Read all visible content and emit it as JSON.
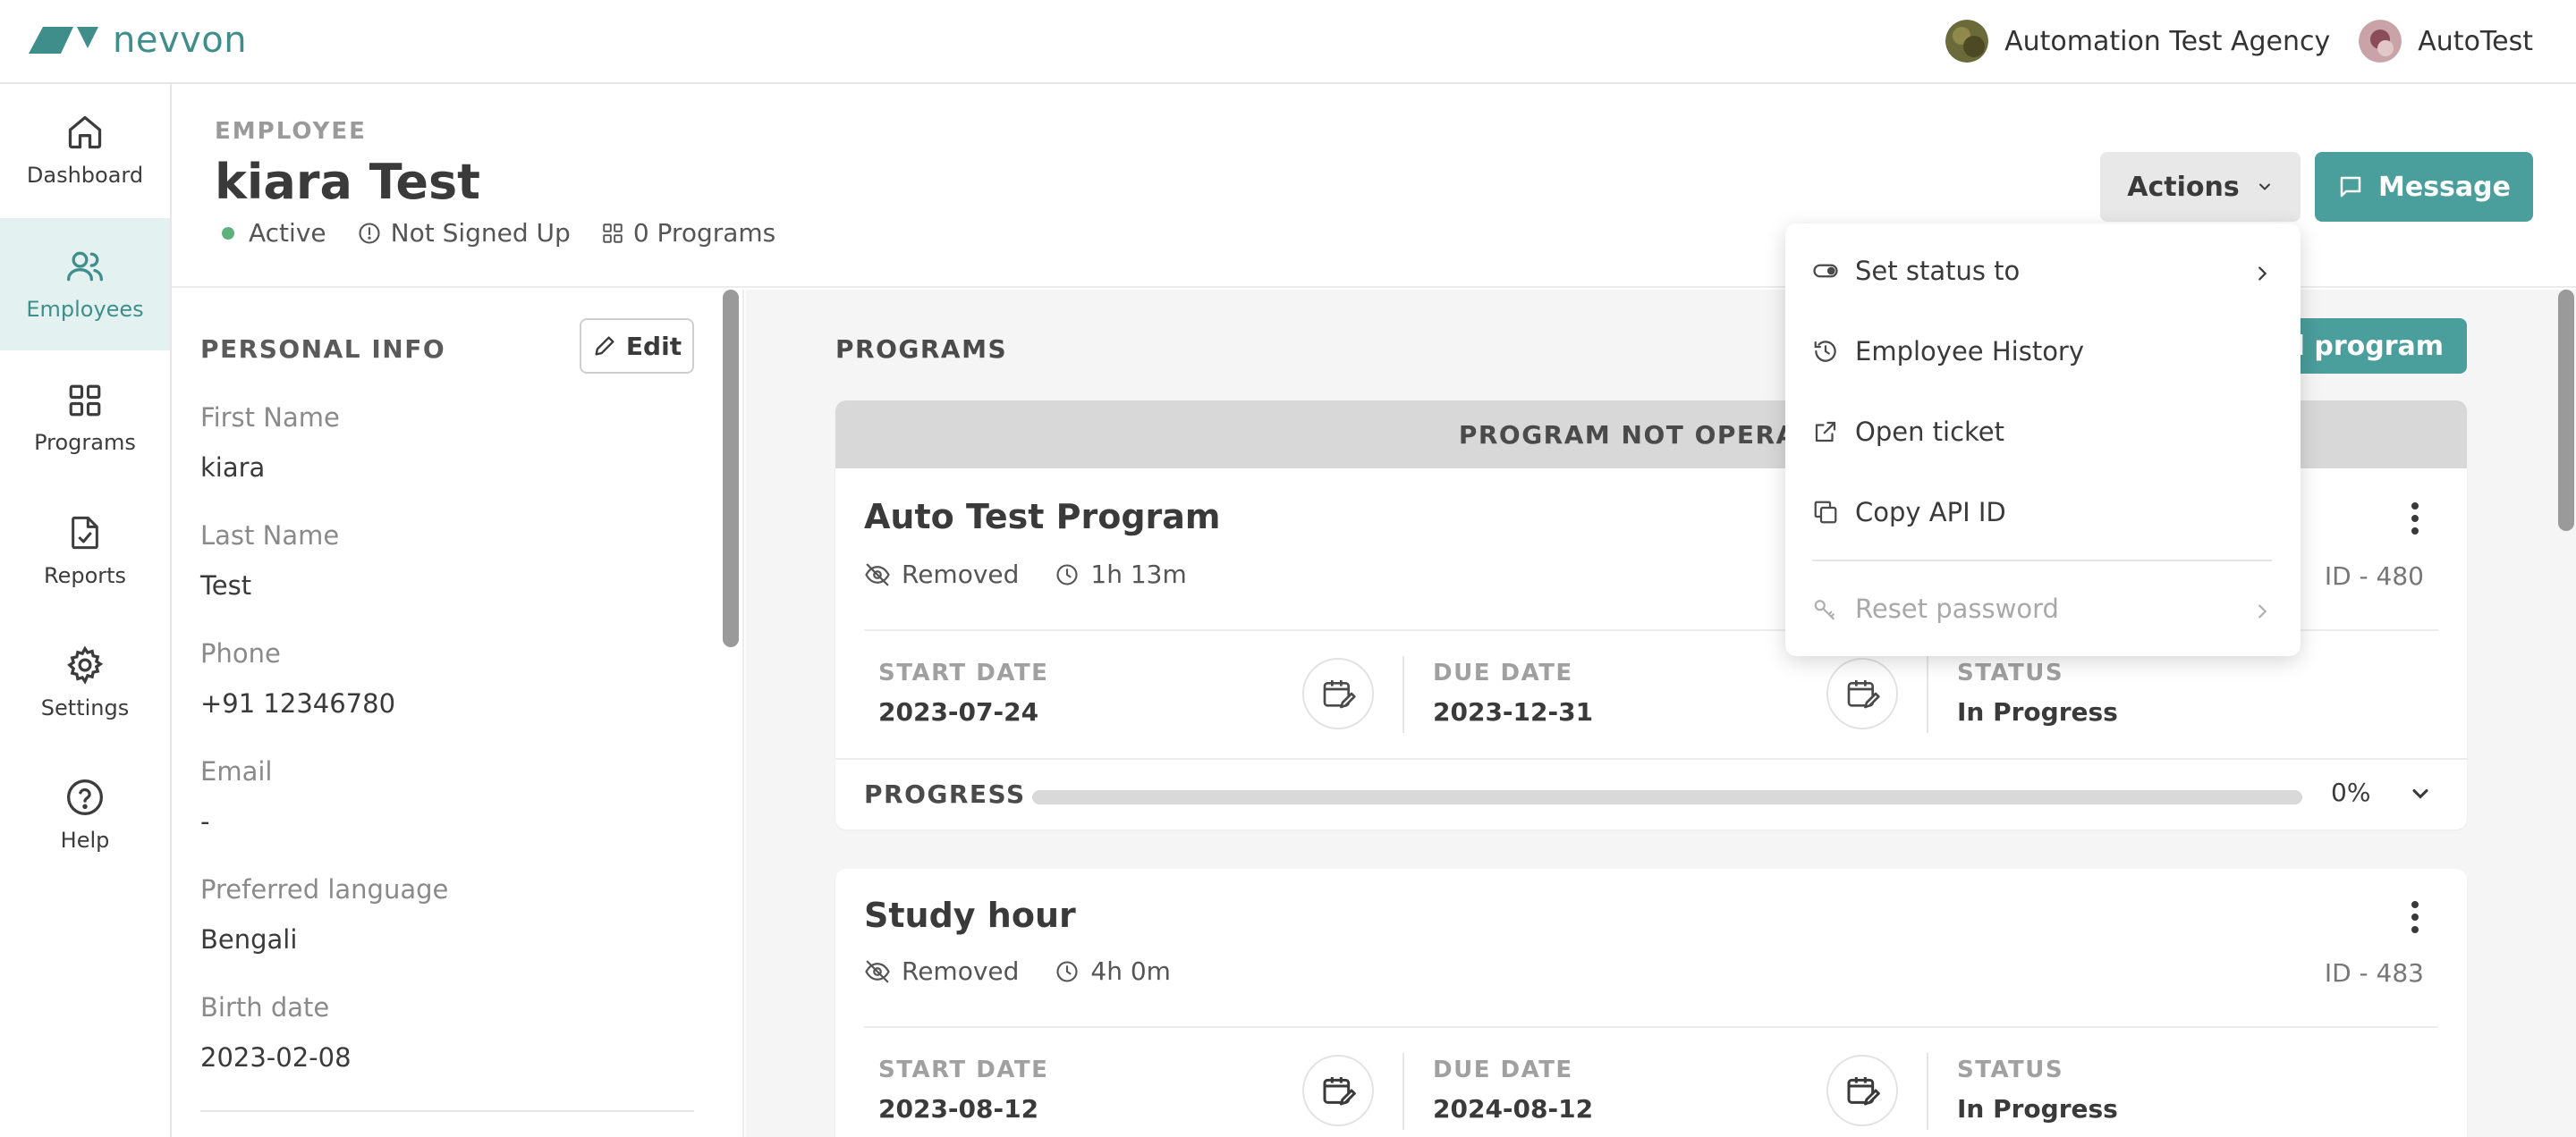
{
  "brand": {
    "name": "nevvon",
    "color": "#3f8e8c"
  },
  "topbar": {
    "org_name": "Automation Test Agency",
    "user_name": "AutoTest"
  },
  "nav": {
    "items": [
      {
        "label": "Dashboard",
        "icon": "home-icon",
        "active": false
      },
      {
        "label": "Employees",
        "icon": "users-icon",
        "active": true
      },
      {
        "label": "Programs",
        "icon": "grid-icon",
        "active": false
      },
      {
        "label": "Reports",
        "icon": "report-icon",
        "active": false
      },
      {
        "label": "Settings",
        "icon": "gear-icon",
        "active": false
      },
      {
        "label": "Help",
        "icon": "help-icon",
        "active": false
      }
    ]
  },
  "employee": {
    "eyebrow": "EMPLOYEE",
    "name": "kiara Test",
    "status": "Active",
    "signup": "Not Signed Up",
    "programs_count": "0 Programs"
  },
  "actions": {
    "actions_label": "Actions",
    "message_label": "Message"
  },
  "personal_info": {
    "title": "PERSONAL INFO",
    "edit_label": "Edit",
    "fields": [
      {
        "label": "First Name",
        "value": "kiara"
      },
      {
        "label": "Last Name",
        "value": "Test"
      },
      {
        "label": "Phone",
        "value": "+91 12346780"
      },
      {
        "label": "Email",
        "value": "-"
      },
      {
        "label": "Preferred language",
        "value": "Bengali"
      },
      {
        "label": "Birth date",
        "value": "2023-02-08"
      }
    ]
  },
  "programs": {
    "title": "PROGRAMS",
    "add_label": "dd program",
    "cards": [
      {
        "banner": "PROGRAM NOT OPERATIC",
        "title": "Auto Test Program",
        "visibility": "Removed",
        "duration": "1h 13m",
        "id_text": "ID - 480",
        "start_label": "START DATE",
        "start_date": "2023-07-24",
        "due_label": "DUE DATE",
        "due_date": "2023-12-31",
        "status_label": "STATUS",
        "status": "In Progress",
        "progress_label": "PROGRESS",
        "progress_text": "0%",
        "progress_value": 0
      },
      {
        "banner": "",
        "title": "Study hour",
        "visibility": "Removed",
        "duration": "4h 0m",
        "id_text": "ID - 483",
        "start_label": "START DATE",
        "start_date": "2023-08-12",
        "due_label": "DUE DATE",
        "due_date": "2024-08-12",
        "status_label": "STATUS",
        "status": "In Progress"
      }
    ]
  },
  "dropdown": {
    "items": [
      {
        "label": "Set status to",
        "icon": "toggle-icon",
        "has_submenu": true,
        "disabled": false
      },
      {
        "label": "Employee History",
        "icon": "history-icon",
        "has_submenu": false,
        "disabled": false
      },
      {
        "label": "Open ticket",
        "icon": "external-link-icon",
        "has_submenu": false,
        "disabled": false
      },
      {
        "label": "Copy API ID",
        "icon": "copy-icon",
        "has_submenu": false,
        "disabled": false
      },
      {
        "label": "Reset password",
        "icon": "key-icon",
        "has_submenu": true,
        "disabled": true
      }
    ]
  },
  "colors": {
    "accent": "#4a9e9b",
    "active_status": "#5cb27a",
    "nav_active_bg": "#e3f1f0"
  }
}
